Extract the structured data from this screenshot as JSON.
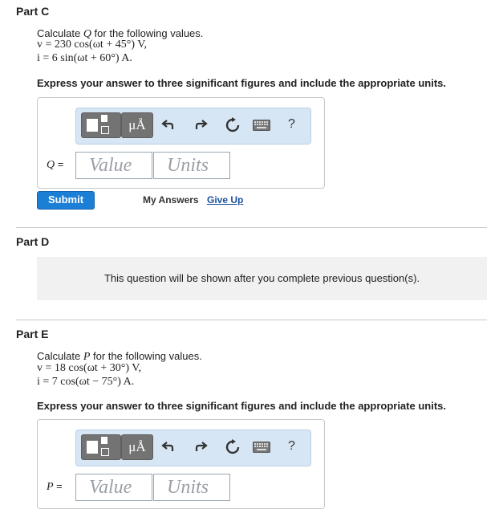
{
  "part_c": {
    "title": "Part C",
    "prompt_pre": "Calculate ",
    "prompt_var": "Q",
    "prompt_post": " for the following values.",
    "eq1": "v = 230 cos(ωt + 45°) V,",
    "eq2": "i = 6 sin(ωt + 60°) A.",
    "instruction": "Express your answer to three significant figures and include the appropriate units.",
    "answer_label": "Q =",
    "value_placeholder": "Value",
    "units_placeholder": "Units",
    "submit_label": "Submit",
    "my_answers_label": "My Answers",
    "give_up_label": "Give Up"
  },
  "part_d": {
    "title": "Part D",
    "locked_message": "This question will be shown after you complete previous question(s)."
  },
  "part_e": {
    "title": "Part E",
    "prompt_pre": "Calculate ",
    "prompt_var": "P",
    "prompt_post": " for the following values.",
    "eq1": "v = 18 cos(ωt + 30°) V,",
    "eq2": "i = 7 cos(ωt − 75°) A.",
    "instruction": "Express your answer to three significant figures and include the appropriate units.",
    "answer_label": "P =",
    "value_placeholder": "Value",
    "units_placeholder": "Units"
  },
  "toolbar": {
    "units_glyph": "μÅ",
    "help_glyph": "?",
    "icons": [
      "templates-icon",
      "units-icon",
      "undo-icon",
      "redo-icon",
      "reset-icon",
      "keyboard-icon",
      "help-icon"
    ]
  }
}
